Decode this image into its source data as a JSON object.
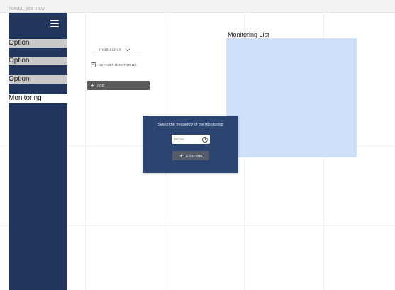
{
  "frame": {
    "label": "TRAVEL_BOX VIEW"
  },
  "sidebar": {
    "background": "#22355a",
    "items": [
      {
        "label": "Option",
        "active": false
      },
      {
        "label": "Option",
        "active": false
      },
      {
        "label": "Option",
        "active": false
      },
      {
        "label": "Monitoring",
        "active": true
      }
    ]
  },
  "controls": {
    "institution_label": "Institution X",
    "default_checkbox_label": "DEFAULT MONITORING",
    "default_checked": true,
    "add_button_label": "ADD"
  },
  "monitoring_list": {
    "title": "Monitoring List",
    "fill_color": "#cfe0fb"
  },
  "frequency_popup": {
    "prompt": "Select the frecuency of the monitoring",
    "time_placeholder": "hh:mm",
    "confirm_label": "CONFIRM",
    "background": "#2c4470"
  },
  "icons": {
    "menu": "hamburger-icon",
    "dropdown": "chevron-down-icon",
    "check": "check-icon",
    "plus": "plus-icon",
    "clock": "clock-icon"
  }
}
